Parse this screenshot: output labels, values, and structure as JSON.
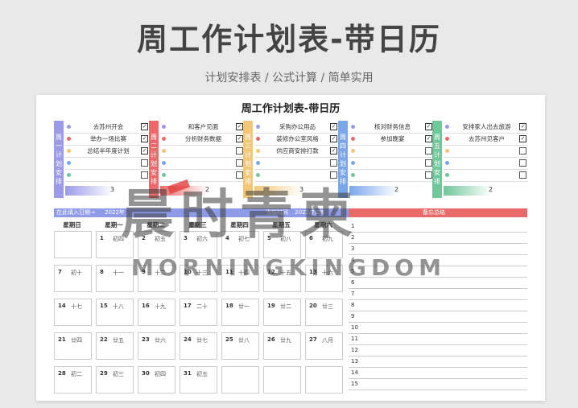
{
  "header": {
    "title": "周工作计划表-带日历",
    "subtitle": "计划安排表 / 公式计算 / 简单实用"
  },
  "sheet": {
    "title": "周工作计划表-带日历"
  },
  "plans": [
    {
      "label": [
        "周",
        "一",
        "计",
        "划",
        "安",
        "排"
      ],
      "color": "#9b9be8",
      "count": "3",
      "tasks": [
        {
          "text": "去苏州开会",
          "done": true
        },
        {
          "text": "举办一场比赛",
          "done": true
        },
        {
          "text": "总结半年度计划",
          "done": true
        },
        {
          "text": "",
          "done": false
        },
        {
          "text": "",
          "done": false
        }
      ]
    },
    {
      "label": [
        "周",
        "二",
        "计",
        "划",
        "安",
        "排"
      ],
      "color": "#e86a6a",
      "count": "2",
      "tasks": [
        {
          "text": "和客户见面",
          "done": true
        },
        {
          "text": "分析财务数据",
          "done": true
        },
        {
          "text": "",
          "done": false
        },
        {
          "text": "",
          "done": false
        },
        {
          "text": "",
          "done": false
        }
      ]
    },
    {
      "label": [
        "周",
        "三",
        "计",
        "划",
        "安",
        "排"
      ],
      "color": "#f2c777",
      "count": "3",
      "tasks": [
        {
          "text": "采购办公用品",
          "done": true
        },
        {
          "text": "装修办公室风格",
          "done": true
        },
        {
          "text": "供应商安排打款",
          "done": true
        },
        {
          "text": "",
          "done": false
        },
        {
          "text": "",
          "done": false
        }
      ]
    },
    {
      "label": [
        "周",
        "四",
        "计",
        "划",
        "安",
        "排"
      ],
      "color": "#7aa6ea",
      "count": "2",
      "tasks": [
        {
          "text": "核对财务信息",
          "done": true
        },
        {
          "text": "参加晚宴",
          "done": true
        },
        {
          "text": "",
          "done": false
        },
        {
          "text": "",
          "done": false
        },
        {
          "text": "",
          "done": false
        }
      ]
    },
    {
      "label": [
        "周",
        "五",
        "计",
        "划",
        "安",
        "排"
      ],
      "color": "#6fc79a",
      "count": "2",
      "tasks": [
        {
          "text": "安排家人出去旅游",
          "done": true
        },
        {
          "text": "去苏州见客户",
          "done": true
        },
        {
          "text": "",
          "done": false
        },
        {
          "text": "",
          "done": false
        },
        {
          "text": "",
          "done": false
        }
      ]
    }
  ],
  "info": {
    "date_prompt": "在此填入日期→",
    "year": "2022年",
    "time_label": "当前时间",
    "time_value": "2022/7/28",
    "notes_label": "备忘总结"
  },
  "weekdays": [
    "星期日",
    "星期一",
    "星期二",
    "星期三",
    "星期四",
    "星期五",
    "星期六"
  ],
  "calendar": [
    [
      {
        "d": "",
        "l": ""
      },
      {
        "d": "1",
        "l": "初四"
      },
      {
        "d": "2",
        "l": "初五"
      },
      {
        "d": "3",
        "l": "初六"
      },
      {
        "d": "4",
        "l": "初七"
      },
      {
        "d": "5",
        "l": "初八"
      },
      {
        "d": "6",
        "l": "初九"
      }
    ],
    [
      {
        "d": "7",
        "l": "初十"
      },
      {
        "d": "8",
        "l": "十一"
      },
      {
        "d": "9",
        "l": "十二"
      },
      {
        "d": "10",
        "l": "十三"
      },
      {
        "d": "11",
        "l": "十四"
      },
      {
        "d": "12",
        "l": "十五"
      },
      {
        "d": "13",
        "l": "十六"
      }
    ],
    [
      {
        "d": "14",
        "l": "十七"
      },
      {
        "d": "15",
        "l": "十八"
      },
      {
        "d": "16",
        "l": "十九"
      },
      {
        "d": "17",
        "l": "二十"
      },
      {
        "d": "18",
        "l": "廿一"
      },
      {
        "d": "19",
        "l": "廿二"
      },
      {
        "d": "20",
        "l": "廿三"
      }
    ],
    [
      {
        "d": "21",
        "l": "廿四"
      },
      {
        "d": "22",
        "l": "廿五"
      },
      {
        "d": "23",
        "l": "廿六"
      },
      {
        "d": "24",
        "l": "廿七"
      },
      {
        "d": "25",
        "l": "廿八"
      },
      {
        "d": "26",
        "l": "廿九"
      },
      {
        "d": "27",
        "l": "八月"
      }
    ],
    [
      {
        "d": "28",
        "l": "初二"
      },
      {
        "d": "29",
        "l": "初三"
      },
      {
        "d": "30",
        "l": "初四"
      },
      {
        "d": "31",
        "l": "初五"
      },
      {
        "d": "",
        "l": ""
      },
      {
        "d": "",
        "l": ""
      },
      {
        "d": "",
        "l": ""
      }
    ]
  ],
  "note_numbers": [
    "1",
    "2",
    "3",
    "4",
    "5",
    "6",
    "7",
    "8",
    "9",
    "10",
    "11",
    "12",
    "13",
    "14",
    "15"
  ],
  "watermark": {
    "text": "晨时青柬",
    "latin": "MORNINGKINGDOM"
  },
  "colors": {
    "infobar_blue": "#8f9be6",
    "infobar_red": "#e86a6a"
  }
}
